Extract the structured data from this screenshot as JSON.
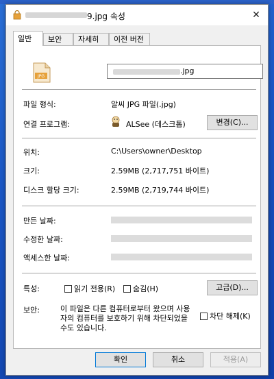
{
  "window": {
    "title_suffix": "9.jpg 속성",
    "close_label": "✕"
  },
  "tabs": [
    {
      "label": "일반",
      "active": true
    },
    {
      "label": "보안"
    },
    {
      "label": "자세히"
    },
    {
      "label": "이전 버전"
    }
  ],
  "general": {
    "file_name_ext": ".jpg",
    "file_type_label": "파일 형식:",
    "file_type_value": "알씨 JPG 파일(.jpg)",
    "open_with_label": "연결 프로그램:",
    "open_with_value": "ALSee (데스크톱)",
    "change_button": "변경(C)...",
    "location_label": "위치:",
    "location_value": "C:\\Users\\owner\\Desktop",
    "size_label": "크기:",
    "size_value": "2.59MB (2,717,751 바이트)",
    "size_on_disk_label": "디스크 할당 크기:",
    "size_on_disk_value": "2.59MB (2,719,744 바이트)",
    "created_label": "만든 날짜:",
    "modified_label": "수정한 날짜:",
    "accessed_label": "액세스한 날짜:",
    "attributes_label": "특성:",
    "readonly_label": "읽기 전용(R)",
    "hidden_label": "숨김(H)",
    "advanced_button": "고급(D)...",
    "security_label": "보안:",
    "security_text": "이 파일은 다른 컴퓨터로부터 왔으며 사용자의 컴퓨터를 보호하기 위해 차단되었을 수도 있습니다.",
    "unblock_label": "차단 해제(K)"
  },
  "footer": {
    "ok": "확인",
    "cancel": "취소",
    "apply": "적용(A)"
  },
  "icons": {
    "file_type": "jpg-file-icon",
    "app": "alsee-app-icon",
    "title": "lock-file-icon"
  },
  "colors": {
    "accent": "#0078d7",
    "file_icon": "#e6a13a"
  }
}
